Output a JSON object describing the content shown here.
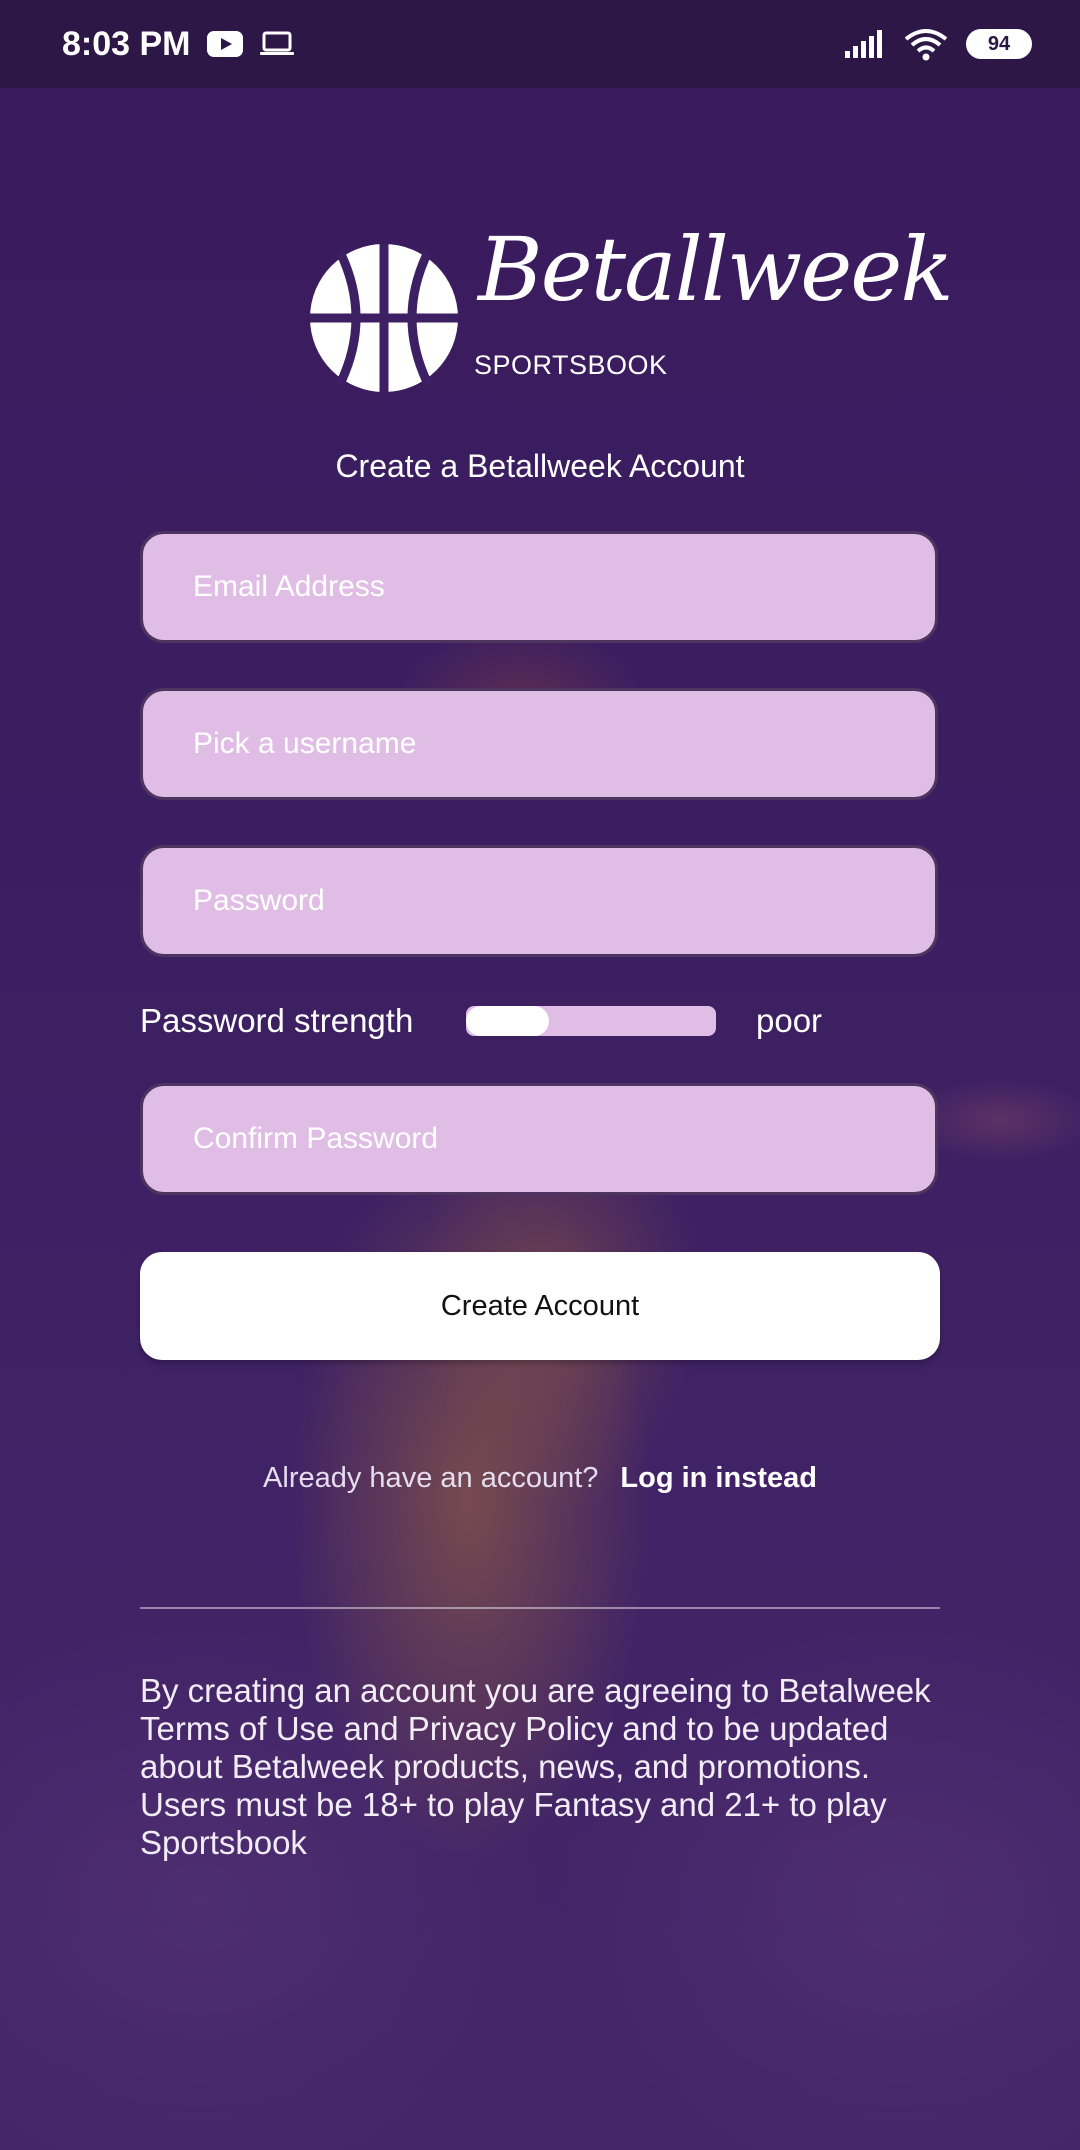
{
  "status_bar": {
    "time": "8:03 PM",
    "battery": "94"
  },
  "brand": {
    "name": "Betallweek",
    "sub": "SPORTSBOOK"
  },
  "page_title": "Create a Betallweek Account",
  "fields": {
    "email_placeholder": "Email Address",
    "username_placeholder": "Pick a username",
    "password_placeholder": "Password",
    "confirm_placeholder": "Confirm Password"
  },
  "strength": {
    "label": "Password strength",
    "value": "poor",
    "level": 0.33
  },
  "create_button": "Create Account",
  "login": {
    "prompt": "Already have an account?",
    "link": "Log in instead"
  },
  "legal_text": "By creating an account you are agreeing to Betalweek Terms of Use and Privacy Policy and to be updated about Betalweek products, news, and promotions. Users must be 18+ to play Fantasy and 21+ to play Sportsbook",
  "icons": [
    "youtube-icon",
    "laptop-icon",
    "signal-icon",
    "wifi-icon",
    "battery-icon",
    "basketball-logo-icon"
  ]
}
